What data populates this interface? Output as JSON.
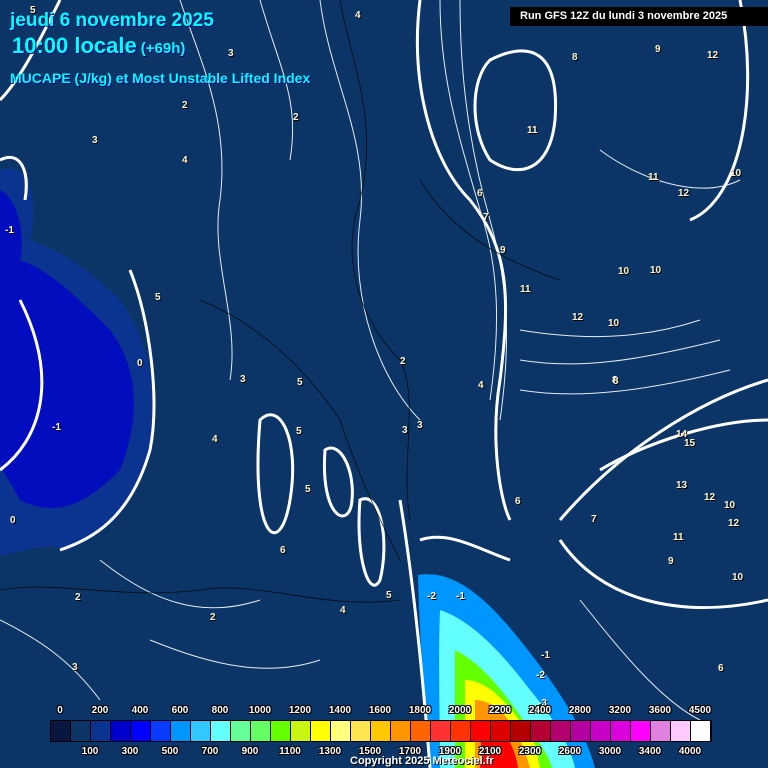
{
  "header": {
    "date": "jeudi 6 novembre 2025",
    "time": "10:00 locale",
    "lead": "(+69h)",
    "product": "MUCAPE (J/kg) et Most Unstable Lifted Index"
  },
  "run_label": "Run GFS 12Z du lundi 3 novembre 2025",
  "copyright": "Copyright 2025 Meteociel.fr",
  "colorbar": {
    "top_labels": [
      "0",
      "200",
      "400",
      "600",
      "800",
      "1000",
      "1200",
      "1400",
      "1600",
      "1800",
      "2000",
      "2200",
      "2400",
      "2800",
      "3200",
      "3600",
      "4500"
    ],
    "bottom_labels": [
      "100",
      "300",
      "500",
      "700",
      "900",
      "1100",
      "1300",
      "1500",
      "1700",
      "1900",
      "2100",
      "2300",
      "2600",
      "3000",
      "3400",
      "4000"
    ],
    "colors": [
      "#081640",
      "#0c3466",
      "#0a3490",
      "#0000cc",
      "#0000ff",
      "#0a3cff",
      "#0096ff",
      "#32c8ff",
      "#64ffff",
      "#64ff96",
      "#64ff64",
      "#64ff00",
      "#c8f514",
      "#ffff00",
      "#ffff80",
      "#ffe650",
      "#ffc800",
      "#ff9600",
      "#ff6400",
      "#ff3232",
      "#ff3200",
      "#ff0000",
      "#dc0000",
      "#b40000",
      "#b40032",
      "#b4006e",
      "#b400a0",
      "#c800c8",
      "#dc00dc",
      "#ff00ff",
      "#e080e0",
      "#ffc8ff",
      "#ffffff"
    ]
  },
  "contour_labels": [
    "5",
    "4",
    "3",
    "2",
    "2",
    "3",
    "4",
    "9",
    "8",
    "12",
    "11",
    "11",
    "12",
    "10",
    "6",
    "7",
    "9",
    "10",
    "10",
    "11",
    "12",
    "10",
    "-1",
    "0",
    "-1",
    "5",
    "5",
    "3",
    "4",
    "5",
    "2",
    "3",
    "4",
    "5",
    "6",
    "8",
    "14",
    "15",
    "13",
    "12",
    "10",
    "12",
    "11",
    "9",
    "10",
    "-2",
    "-1",
    "-2",
    "-1",
    "-3",
    "0",
    "2",
    "3",
    "2",
    "3",
    "6",
    "6",
    "5",
    "4",
    "7",
    "8"
  ]
}
